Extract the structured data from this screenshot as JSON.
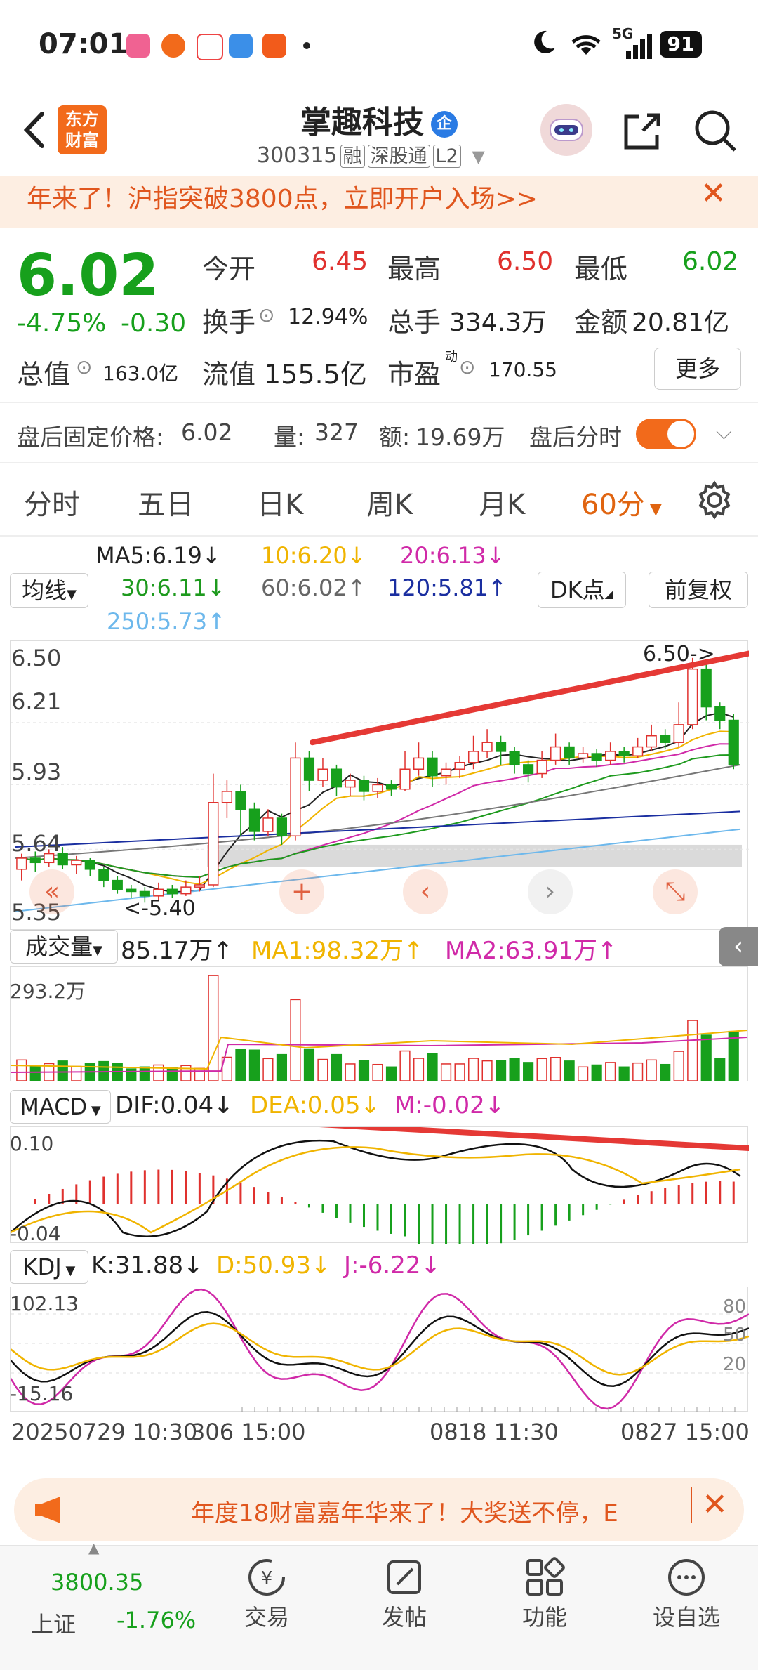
{
  "status_bar": {
    "time": "07:01",
    "network": "5G",
    "battery": "91",
    "app_icons": [
      "bilibili-icon",
      "weibo-icon",
      "map-icon",
      "weather-icon",
      "feishu-icon"
    ]
  },
  "header": {
    "logo_text_1": "东方",
    "logo_text_2": "财富",
    "stock_name": "掌趣科技",
    "badge": "企",
    "code": "300315",
    "tag_rong": "融",
    "tag_sgt": "深股通",
    "tag_l2": "L2"
  },
  "banner": {
    "text": "年来了！沪指突破3800点，立即开户入场>>"
  },
  "quote": {
    "price": "6.02",
    "change_pct": "-4.75%",
    "change": "-0.30",
    "open_label": "今开",
    "open_value": "6.45",
    "high_label": "最高",
    "high_value": "6.50",
    "low_label": "最低",
    "low_value": "6.02",
    "turnover_label": "换手",
    "turnover_value": "12.94%",
    "volume_label": "总手",
    "volume_value": "334.3万",
    "amount_label": "金额",
    "amount_value": "20.81亿",
    "mktcap_label": "总值",
    "mktcap_value": "163.0亿",
    "float_label": "流值",
    "float_value": "155.5亿",
    "pe_label": "市盈",
    "pe_sup": "动",
    "pe_value": "170.55",
    "more": "更多"
  },
  "post_market": {
    "price_label": "盘后固定价格:",
    "price_value": "6.02",
    "vol_label": "量:",
    "vol_value": "327",
    "amt_label": "额:",
    "amt_value": "19.69万",
    "switch_label": "盘后分时"
  },
  "tabs": [
    "分时",
    "五日",
    "日K",
    "周K",
    "月K",
    "60分"
  ],
  "ma_legend": {
    "selector": "均线",
    "ma5": "MA5:6.19",
    "ma10": "10:6.20",
    "ma20": "20:6.13",
    "ma30": "30:6.11",
    "ma60": "60:6.02",
    "ma120": "120:5.81",
    "ma250": "250:5.73",
    "dk": "DK点",
    "fuquan": "前复权"
  },
  "kline": {
    "y_labels": [
      "6.50",
      "6.21",
      "5.93",
      "5.64",
      "5.35"
    ],
    "high_marker": "6.50->",
    "low_marker": "<-5.40",
    "candles": [
      [
        5.55,
        5.6,
        5.62,
        5.5
      ],
      [
        5.6,
        5.58,
        5.63,
        5.54
      ],
      [
        5.58,
        5.62,
        5.64,
        5.56
      ],
      [
        5.62,
        5.57,
        5.65,
        5.55
      ],
      [
        5.57,
        5.59,
        5.61,
        5.53
      ],
      [
        5.59,
        5.55,
        5.6,
        5.52
      ],
      [
        5.55,
        5.5,
        5.56,
        5.47
      ],
      [
        5.5,
        5.46,
        5.52,
        5.44
      ],
      [
        5.46,
        5.45,
        5.48,
        5.42
      ],
      [
        5.45,
        5.43,
        5.47,
        5.4
      ],
      [
        5.43,
        5.46,
        5.49,
        5.41
      ],
      [
        5.46,
        5.44,
        5.48,
        5.42
      ],
      [
        5.44,
        5.47,
        5.5,
        5.43
      ],
      [
        5.47,
        5.48,
        5.52,
        5.45
      ],
      [
        5.48,
        5.85,
        5.98,
        5.47
      ],
      [
        5.85,
        5.9,
        5.95,
        5.78
      ],
      [
        5.9,
        5.82,
        5.93,
        5.7
      ],
      [
        5.82,
        5.72,
        5.85,
        5.68
      ],
      [
        5.72,
        5.78,
        5.82,
        5.7
      ],
      [
        5.78,
        5.7,
        5.8,
        5.66
      ],
      [
        5.7,
        6.05,
        6.12,
        5.68
      ],
      [
        6.05,
        5.95,
        6.08,
        5.9
      ],
      [
        5.95,
        6.0,
        6.05,
        5.92
      ],
      [
        6.0,
        5.92,
        6.02,
        5.88
      ],
      [
        5.92,
        5.95,
        5.98,
        5.88
      ],
      [
        5.95,
        5.9,
        5.97,
        5.86
      ],
      [
        5.9,
        5.93,
        5.96,
        5.87
      ],
      [
        5.93,
        5.91,
        5.95,
        5.88
      ],
      [
        5.91,
        6.0,
        6.08,
        5.9
      ],
      [
        6.0,
        6.05,
        6.12,
        5.97
      ],
      [
        6.05,
        5.97,
        6.08,
        5.92
      ],
      [
        5.97,
        6.0,
        6.03,
        5.93
      ],
      [
        6.0,
        6.03,
        6.06,
        5.96
      ],
      [
        6.03,
        6.08,
        6.15,
        6.0
      ],
      [
        6.08,
        6.12,
        6.18,
        6.05
      ],
      [
        6.12,
        6.08,
        6.15,
        6.02
      ],
      [
        6.08,
        6.02,
        6.1,
        5.98
      ],
      [
        6.02,
        5.98,
        6.04,
        5.94
      ],
      [
        5.98,
        6.04,
        6.08,
        5.96
      ],
      [
        6.04,
        6.1,
        6.16,
        6.02
      ],
      [
        6.1,
        6.05,
        6.12,
        6.02
      ],
      [
        6.05,
        6.07,
        6.1,
        6.03
      ],
      [
        6.07,
        6.04,
        6.09,
        6.01
      ],
      [
        6.04,
        6.08,
        6.12,
        6.02
      ],
      [
        6.08,
        6.06,
        6.1,
        6.03
      ],
      [
        6.06,
        6.1,
        6.14,
        6.05
      ],
      [
        6.1,
        6.15,
        6.2,
        6.08
      ],
      [
        6.15,
        6.12,
        6.18,
        6.09
      ],
      [
        6.12,
        6.2,
        6.3,
        6.1
      ],
      [
        6.2,
        6.45,
        6.5,
        6.18
      ],
      [
        6.45,
        6.28,
        6.48,
        6.22
      ],
      [
        6.28,
        6.22,
        6.3,
        6.18
      ],
      [
        6.22,
        6.02,
        6.25,
        6.0
      ]
    ]
  },
  "volume": {
    "selector": "成交量",
    "value": "85.17万",
    "ma1": "MA1:98.32万",
    "ma2": "MA2:63.91万",
    "top_label": "293.2万"
  },
  "macd": {
    "selector": "MACD",
    "dif": "DIF:0.04",
    "dea": "DEA:0.05",
    "m": "M:-0.02",
    "top_label": "0.10",
    "bottom_label": "-0.04"
  },
  "kdj": {
    "selector": "KDJ",
    "k": "K:31.88",
    "d": "D:50.93",
    "j": "J:-6.22",
    "top_label": "102.13",
    "bottom_label": "-15.16",
    "right_labels": [
      "80",
      "50",
      "20"
    ]
  },
  "x_axis": [
    "20250729 10:30",
    "306 15:00",
    "0818 11:30",
    "0827 15:00"
  ],
  "bottom_banner": {
    "text": "年度18财富嘉年华来了！大奖送不停，E"
  },
  "nav": {
    "index_value": "3800.35",
    "index_name": "上证",
    "index_change": "-1.76%",
    "items": [
      "交易",
      "发帖",
      "功能",
      "设自选"
    ]
  },
  "colors": {
    "up": "#e0312e",
    "down": "#17a01c",
    "accent": "#f26a1b",
    "ma5": "#222222",
    "ma10": "#f0b400",
    "ma20": "#d02aa8",
    "ma30": "#1e9a1e",
    "ma60": "#777777",
    "ma120": "#1a2ea0",
    "ma250": "#6db8ec"
  }
}
